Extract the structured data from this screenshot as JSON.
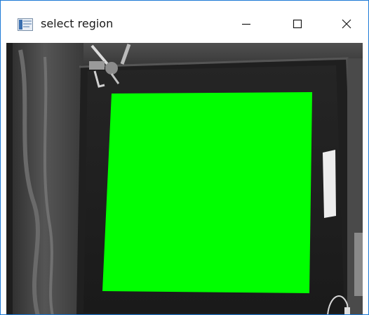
{
  "window": {
    "title": "select region",
    "icon": "opencv-window-icon"
  },
  "controls": {
    "minimize_icon": "minimize-icon",
    "maximize_icon": "maximize-icon",
    "close_icon": "close-icon"
  },
  "image": {
    "description_color": "#3c3c3c",
    "selection_color": "#00ff00"
  }
}
